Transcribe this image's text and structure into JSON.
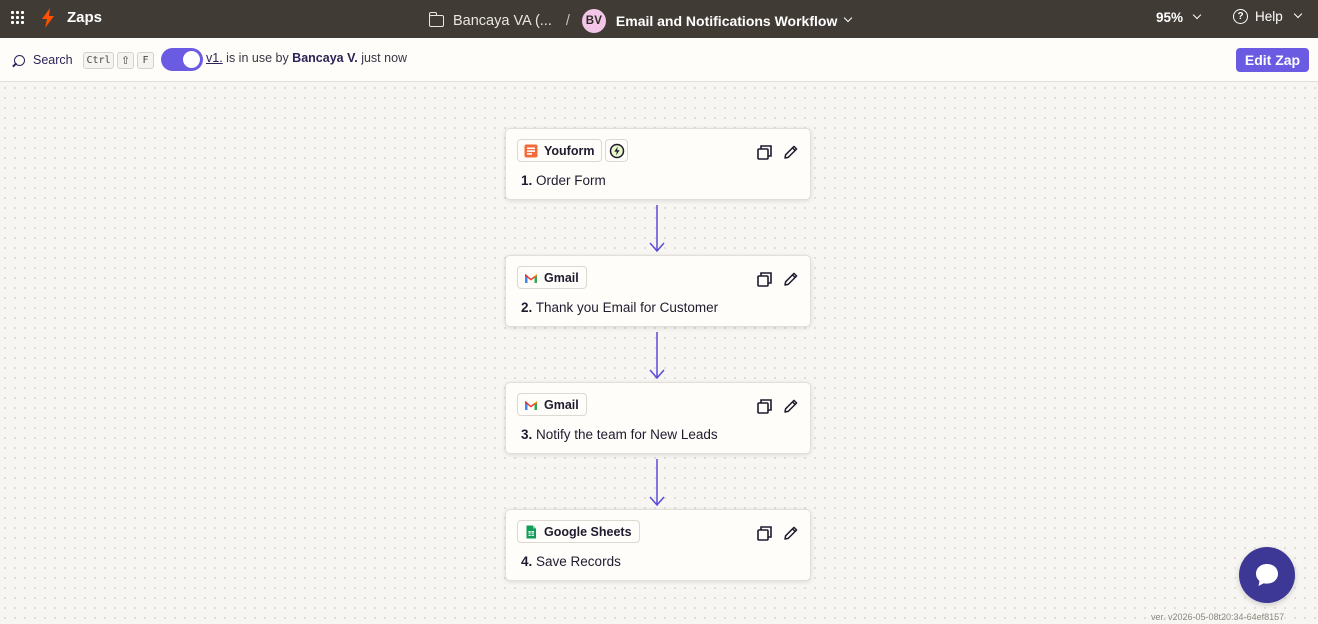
{
  "topbar": {
    "brand": "Zaps",
    "folder_name": "Bancaya VA (...",
    "separator": "/",
    "owner_initials": "BV",
    "workflow_name": "Email and Notifications Workflow",
    "zoom": "95%",
    "help": "Help"
  },
  "subbar": {
    "search_label": "Search",
    "shortcut_keys": [
      "Ctrl",
      "⇧",
      "F"
    ],
    "version": "v1.",
    "status_text": " is in use by ",
    "user": "Bancaya V.",
    "time": " just now",
    "edit_button": "Edit Zap"
  },
  "steps": [
    {
      "app": "Youform",
      "number": "1.",
      "title": "Order Form",
      "trigger": true,
      "icon": "youform-logo"
    },
    {
      "app": "Gmail",
      "number": "2.",
      "title": "Thank you Email for Customer",
      "trigger": false,
      "icon": "gmail-logo"
    },
    {
      "app": "Gmail",
      "number": "3.",
      "title": "Notify the team for New Leads",
      "trigger": false,
      "icon": "gmail-logo"
    },
    {
      "app": "Google Sheets",
      "number": "4.",
      "title": "Save Records",
      "trigger": false,
      "icon": "google-sheets-logo"
    }
  ],
  "footer": {
    "version": "ver. v2026-05-08t20:34-64ef8157"
  },
  "colors": {
    "topbar": "#403b35",
    "accent": "#6b5be3",
    "brand_orange": "#ff4f00",
    "chat": "#3d3896"
  }
}
